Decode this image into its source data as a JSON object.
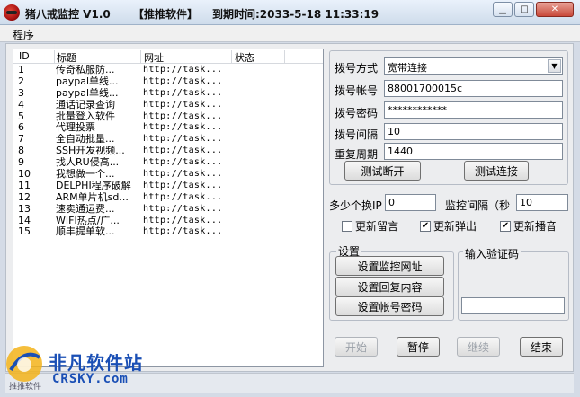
{
  "window": {
    "app_title": "猪八戒监控 V1.0",
    "tag": "【推推软件】",
    "expiry": "到期时间:2033-5-18 11:33:19"
  },
  "menu": {
    "program": "程序"
  },
  "list": {
    "columns": [
      "ID",
      "标题",
      "网址",
      "状态"
    ],
    "rows": [
      {
        "id": "1",
        "title": "传奇私服防...",
        "url": "http://task...",
        "status": ""
      },
      {
        "id": "2",
        "title": "paypal单线...",
        "url": "http://task...",
        "status": ""
      },
      {
        "id": "3",
        "title": "paypal单线...",
        "url": "http://task...",
        "status": ""
      },
      {
        "id": "4",
        "title": "通话记录查询",
        "url": "http://task...",
        "status": ""
      },
      {
        "id": "5",
        "title": "批量登入软件",
        "url": "http://task...",
        "status": ""
      },
      {
        "id": "6",
        "title": "代理投票",
        "url": "http://task...",
        "status": ""
      },
      {
        "id": "7",
        "title": "全自动批量...",
        "url": "http://task...",
        "status": ""
      },
      {
        "id": "8",
        "title": "SSH开发视频...",
        "url": "http://task...",
        "status": ""
      },
      {
        "id": "9",
        "title": "找人RU侵高...",
        "url": "http://task...",
        "status": ""
      },
      {
        "id": "10",
        "title": "我想做一个...",
        "url": "http://task...",
        "status": ""
      },
      {
        "id": "11",
        "title": "DELPHI程序破解",
        "url": "http://task...",
        "status": ""
      },
      {
        "id": "12",
        "title": "ARM单片机sd...",
        "url": "http://task...",
        "status": ""
      },
      {
        "id": "13",
        "title": "速卖通运费...",
        "url": "http://task...",
        "status": ""
      },
      {
        "id": "14",
        "title": "WIFI热点/广...",
        "url": "http://task...",
        "status": ""
      },
      {
        "id": "15",
        "title": "顺丰提单软...",
        "url": "http://task...",
        "status": ""
      }
    ]
  },
  "dial": {
    "method_label": "拨号方式",
    "method_value": "宽带连接",
    "account_label": "拨号帐号",
    "account_value": "88001700015c",
    "password_label": "拨号密码",
    "password_value": "************",
    "interval_label": "拨号间隔",
    "interval_value": "10",
    "period_label": "重复周期",
    "period_value": "1440",
    "test_disconnect": "测试断开",
    "test_connect": "测试连接"
  },
  "options": {
    "ip_label": "多少个换IP",
    "ip_value": "0",
    "monitor_label": "监控间隔（秒",
    "monitor_value": "10",
    "update_message": "更新留言",
    "update_popup": "更新弹出",
    "update_sound": "更新播音",
    "update_message_checked": false,
    "update_popup_checked": true,
    "update_sound_checked": true
  },
  "settings": {
    "title": "设置",
    "set_url": "设置监控网址",
    "set_reply": "设置回复内容",
    "set_account": "设置帐号密码"
  },
  "captcha": {
    "label": "输入验证码",
    "value": ""
  },
  "actions": {
    "start": "开始",
    "pause": "暂停",
    "resume": "继续",
    "end": "结束"
  },
  "watermark": {
    "brand": "非凡软件站",
    "domain": "CRSKY.com",
    "note": "推推软件"
  },
  "colors": {
    "accent_blue": "#1a4fb5",
    "close_red": "#c9493a"
  }
}
